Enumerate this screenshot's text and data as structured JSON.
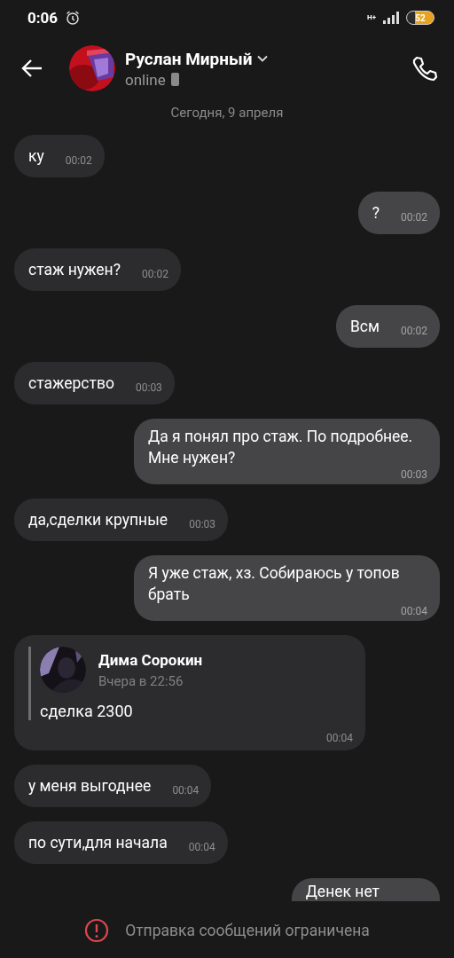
{
  "status_bar": {
    "time": "0:06",
    "network": "H+",
    "battery": "52"
  },
  "header": {
    "name": "Руслан Мирный",
    "status": "online"
  },
  "date_divider": "Сегодня, 9 апреля",
  "messages": [
    {
      "kind": "text",
      "outgoing": false,
      "text": "ку",
      "time": "00:02"
    },
    {
      "kind": "text",
      "outgoing": true,
      "text": "?",
      "time": "00:02"
    },
    {
      "kind": "text",
      "outgoing": false,
      "text": "стаж нужен?",
      "time": "00:02"
    },
    {
      "kind": "text",
      "outgoing": true,
      "text": "Всм",
      "time": "00:02"
    },
    {
      "kind": "text",
      "outgoing": false,
      "text": "стажерство",
      "time": "00:03"
    },
    {
      "kind": "long",
      "outgoing": true,
      "text": "Да я понял про стаж. По подробнее. Мне нужен?",
      "time": "00:03"
    },
    {
      "kind": "text",
      "outgoing": false,
      "text": "да,сделки крупные",
      "time": "00:03"
    },
    {
      "kind": "long",
      "outgoing": true,
      "text": "Я уже стаж, хз. Собираюсь у топов брать",
      "time": "00:04"
    },
    {
      "kind": "quote",
      "outgoing": false,
      "author": "Дима Сорокин",
      "date": "Вчера в 22:56",
      "text": "сделка 2300",
      "time": "00:04"
    },
    {
      "kind": "text",
      "outgoing": false,
      "text": "у меня выгоднее",
      "time": "00:04"
    },
    {
      "kind": "text",
      "outgoing": false,
      "text": "по сути,для начала",
      "time": "00:04"
    },
    {
      "kind": "partial",
      "outgoing": true,
      "text": "Денек нет"
    }
  ],
  "notice": "Отправка сообщений ограничена"
}
